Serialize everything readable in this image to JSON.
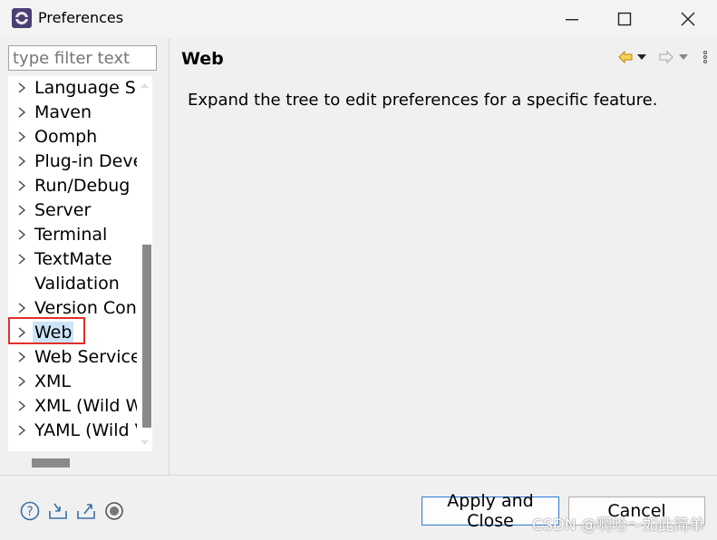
{
  "window": {
    "title": "Preferences"
  },
  "filter": {
    "placeholder": "type filter text"
  },
  "tree": {
    "items": [
      {
        "label": "Language Se",
        "expandable": true
      },
      {
        "label": "Maven",
        "expandable": true
      },
      {
        "label": "Oomph",
        "expandable": true
      },
      {
        "label": "Plug-in Deve",
        "expandable": true
      },
      {
        "label": "Run/Debug",
        "expandable": true
      },
      {
        "label": "Server",
        "expandable": true
      },
      {
        "label": "Terminal",
        "expandable": true
      },
      {
        "label": "TextMate",
        "expandable": true
      },
      {
        "label": "Validation",
        "expandable": false
      },
      {
        "label": "Version Cont",
        "expandable": true
      },
      {
        "label": "Web",
        "expandable": true,
        "selected": true
      },
      {
        "label": "Web Services",
        "expandable": true
      },
      {
        "label": "XML",
        "expandable": true
      },
      {
        "label": "XML (Wild W",
        "expandable": true
      },
      {
        "label": "YAML (Wild V",
        "expandable": true
      }
    ]
  },
  "page": {
    "title": "Web",
    "description": "Expand the tree to edit preferences for a specific feature."
  },
  "buttons": {
    "apply_close": "Apply and Close",
    "cancel": "Cancel"
  },
  "watermark": "CSDN @啊哈～如此简单",
  "colors": {
    "selection": "#cce4f7",
    "highlight_box": "#e0302a",
    "default_button_border": "#2a7ad4",
    "back_arrow": "#e0a800"
  }
}
